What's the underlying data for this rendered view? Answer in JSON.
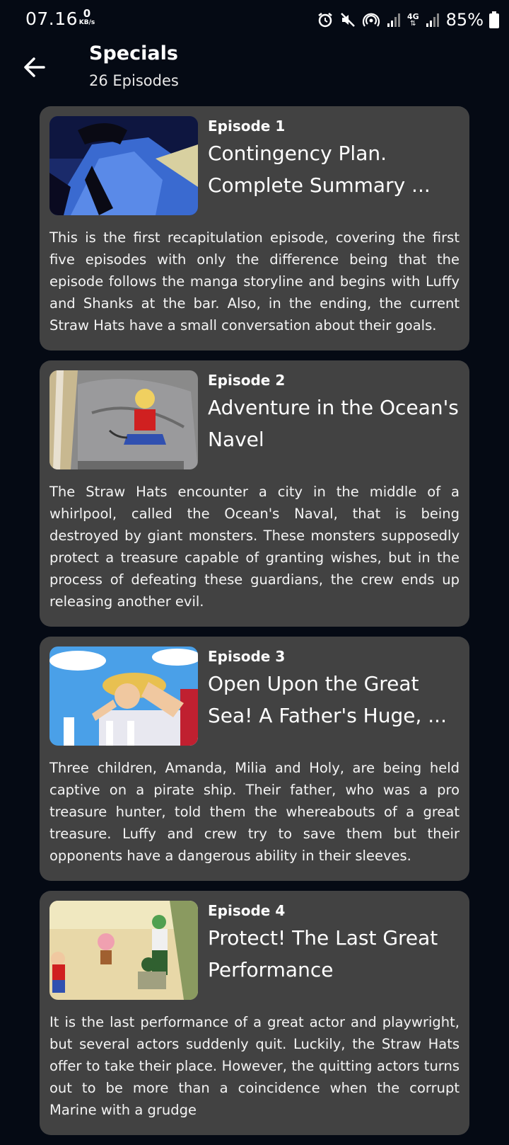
{
  "status_bar": {
    "time": "07.16",
    "speed_value": "0",
    "speed_unit": "KB/s",
    "network": "4G",
    "battery": "85%"
  },
  "header": {
    "title": "Specials",
    "subtitle": "26 Episodes"
  },
  "episodes": [
    {
      "number": "Episode 1",
      "title": "Contingency Plan. Complete Summary ...",
      "description": "This is the first recapitulation episode, covering the first five episodes with only the difference being that the episode follows the manga storyline and begins with Luffy and Shanks at the bar. Also, in the ending, the current Straw Hats have a small conversation about their goals."
    },
    {
      "number": "Episode 2",
      "title": "Adventure in the Ocean's Navel",
      "description": "The Straw Hats encounter a city in the middle of a whirlpool, called the Ocean's Naval, that is being destroyed by giant monsters. These monsters supposedly protect a treasure capable of granting wishes, but in the process of defeating these guardians, the crew ends up releasing another evil."
    },
    {
      "number": "Episode 3",
      "title": "Open Upon the Great Sea! A Father's Huge, ...",
      "description": "Three children, Amanda, Milia and Holy, are being held captive on a pirate ship. Their father, who was a pro treasure hunter, told them the whereabouts of a great treasure. Luffy and crew try to save them but their opponents have a dangerous ability in their sleeves."
    },
    {
      "number": "Episode 4",
      "title": "Protect! The Last Great Performance",
      "description": "It is the last performance of a great actor and playwright, but several actors suddenly quit. Luckily, the Straw Hats offer to take their place. However, the quitting actors turns out to be more than a coincidence when the corrupt Marine with a grudge"
    }
  ]
}
